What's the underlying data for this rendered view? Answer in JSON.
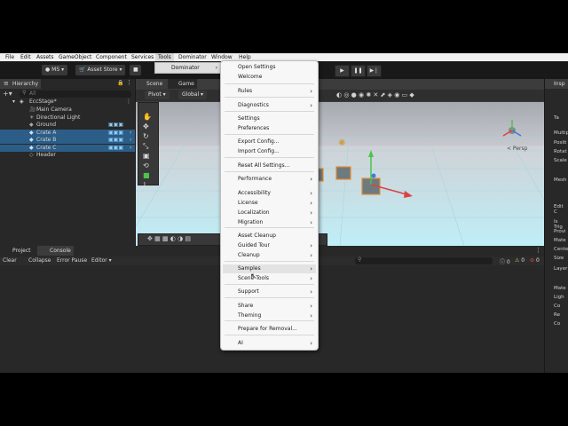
{
  "menubar": [
    "File",
    "Edit",
    "Assets",
    "GameObject",
    "Component",
    "Services",
    "Tools",
    "Dominator",
    "Window",
    "Help"
  ],
  "toolbar": {
    "account": "MS",
    "asset_store": "Asset Store"
  },
  "submenu": {
    "label": "Dominator"
  },
  "hierarchy": {
    "tab": "Hierarchy",
    "search_placeholder": "All",
    "scene": "EccStage*",
    "items": [
      {
        "label": "Main Camera",
        "selected": false
      },
      {
        "label": "Directional Light",
        "selected": false
      },
      {
        "label": "Ground",
        "selected": false
      },
      {
        "label": "Crate A",
        "selected": true
      },
      {
        "label": "Crate B",
        "selected": true
      },
      {
        "label": "Crate C",
        "selected": true
      },
      {
        "label": "Header",
        "selected": false
      }
    ]
  },
  "scene": {
    "tabs": [
      "Scene",
      "Game"
    ],
    "pivot": "Pivot",
    "global": "Global",
    "persp": "< Persp"
  },
  "bottom": {
    "tabs": [
      "Project",
      "Console"
    ],
    "buttons": [
      "Clear",
      "Collapse",
      "Error Pause",
      "Editor"
    ],
    "counts": [
      "0",
      "0",
      "0"
    ]
  },
  "inspector": {
    "tab": "Insp",
    "lines": [
      "Ta",
      "Multip",
      "Positi",
      "Rotat",
      "Scale",
      "Mesh",
      "Edit C",
      "Is Trig",
      "Provi",
      "Mate",
      "Cente",
      "Size",
      "Layer",
      "Mate",
      "Ligh",
      "Co",
      "Re",
      "Co"
    ]
  },
  "dropdown": {
    "items": [
      {
        "label": "Open Settings",
        "sub": false
      },
      {
        "label": "Welcome",
        "sub": false
      },
      {
        "label": "Rules",
        "sub": true
      },
      {
        "label": "Diagnostics",
        "sub": true
      },
      {
        "label": "Settings",
        "sub": false
      },
      {
        "label": "Preferences",
        "sub": false
      },
      {
        "label": "Export Config...",
        "sub": false
      },
      {
        "label": "Import Config...",
        "sub": false
      },
      {
        "label": "Reset All Settings...",
        "sub": false
      },
      {
        "label": "Performance",
        "sub": true
      },
      {
        "label": "Accessibility",
        "sub": true
      },
      {
        "label": "License",
        "sub": true
      },
      {
        "label": "Localization",
        "sub": true
      },
      {
        "label": "Migration",
        "sub": true
      },
      {
        "label": "Asset Cleanup",
        "sub": false
      },
      {
        "label": "Guided Tour",
        "sub": true
      },
      {
        "label": "Cleanup",
        "sub": true
      },
      {
        "label": "Samples",
        "sub": true
      },
      {
        "label": "Scene Tools",
        "sub": true
      },
      {
        "label": "Support",
        "sub": true
      },
      {
        "label": "Share",
        "sub": true
      },
      {
        "label": "Theming",
        "sub": true
      },
      {
        "label": "Prepare for Removal...",
        "sub": false
      },
      {
        "label": "AI",
        "sub": true
      }
    ]
  },
  "colors": {
    "selection": "#2c5d87",
    "menu_bg": "#f7f7f7",
    "editor_bg": "#191919",
    "accent": "#5fb8ff"
  }
}
